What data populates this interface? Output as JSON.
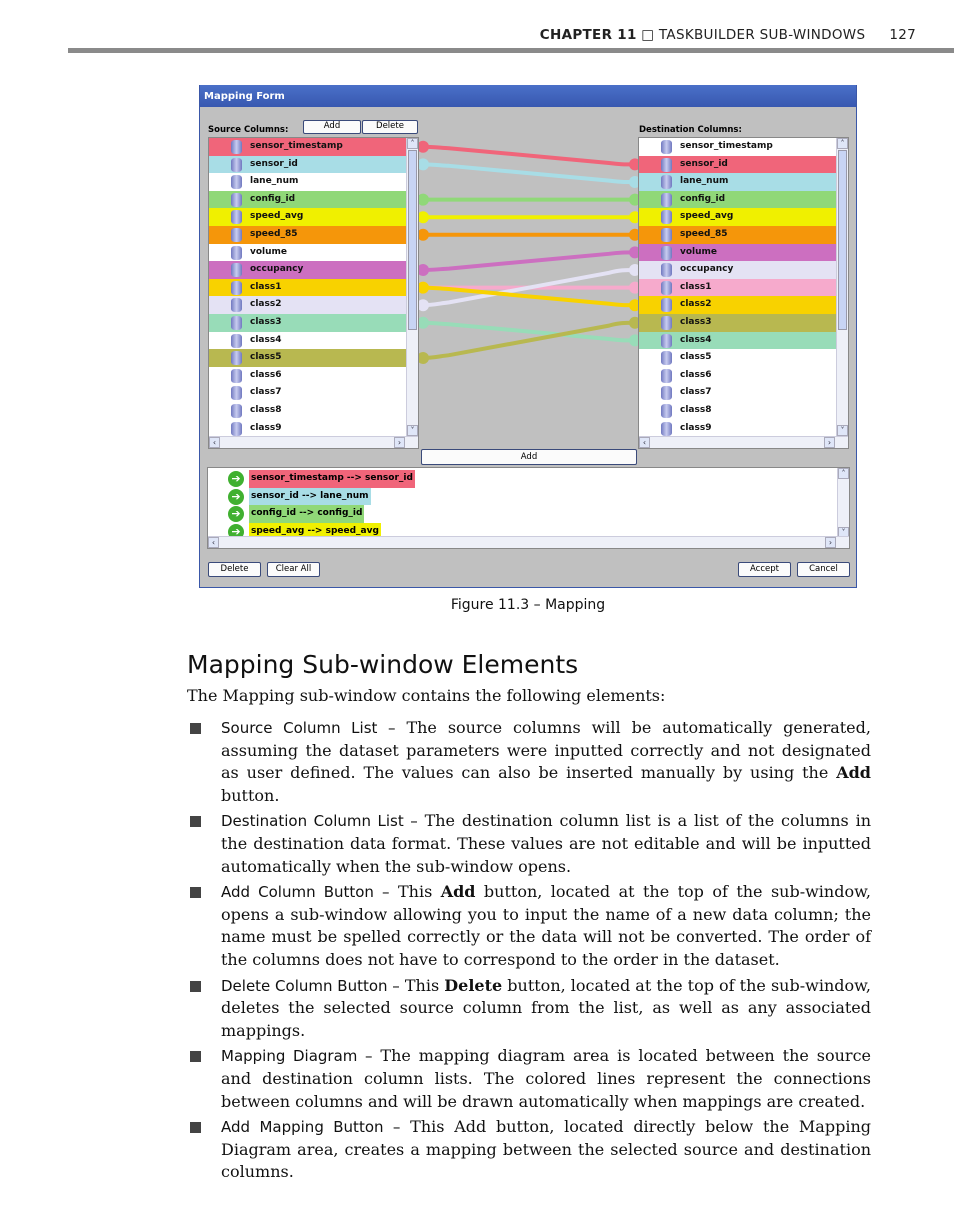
{
  "header": {
    "chapter": "CHAPTER 11",
    "separator": "□",
    "section": "TASKBUILDER SUB-WINDOWS",
    "page": "127"
  },
  "window": {
    "title": "Mapping Form",
    "source_label": "Source Columns:",
    "dest_label": "Destination Columns:",
    "add": "Add",
    "delete": "Delete",
    "add_mapping": "Add",
    "delete_mapping": "Delete",
    "clear_all": "Clear All",
    "accept": "Accept",
    "cancel": "Cancel",
    "source": [
      {
        "name": "sensor_timestamp",
        "color": "#f0657a"
      },
      {
        "name": "sensor_id",
        "color": "#a8dde6"
      },
      {
        "name": "lane_num",
        "color": "#ffffff"
      },
      {
        "name": "config_id",
        "color": "#90d878"
      },
      {
        "name": "speed_avg",
        "color": "#f0f000"
      },
      {
        "name": "speed_85",
        "color": "#f5960a"
      },
      {
        "name": "volume",
        "color": "#ffffff"
      },
      {
        "name": "occupancy",
        "color": "#cc6fc0"
      },
      {
        "name": "class1",
        "color": "#f8d200"
      },
      {
        "name": "class2",
        "color": "#e4e2f4"
      },
      {
        "name": "class3",
        "color": "#98dcb8"
      },
      {
        "name": "class4",
        "color": "#ffffff"
      },
      {
        "name": "class5",
        "color": "#b8b850"
      },
      {
        "name": "class6",
        "color": "#ffffff"
      },
      {
        "name": "class7",
        "color": "#ffffff"
      },
      {
        "name": "class8",
        "color": "#ffffff"
      },
      {
        "name": "class9",
        "color": "#ffffff"
      }
    ],
    "destination": [
      {
        "name": "sensor_timestamp",
        "color": "#ffffff"
      },
      {
        "name": "sensor_id",
        "color": "#f0657a"
      },
      {
        "name": "lane_num",
        "color": "#a8dde6"
      },
      {
        "name": "config_id",
        "color": "#90d878"
      },
      {
        "name": "speed_avg",
        "color": "#f0f000"
      },
      {
        "name": "speed_85",
        "color": "#f5960a"
      },
      {
        "name": "volume",
        "color": "#cc6fc0"
      },
      {
        "name": "occupancy",
        "color": "#e4e2f4"
      },
      {
        "name": "class1",
        "color": "#f6aacc"
      },
      {
        "name": "class2",
        "color": "#f8d200"
      },
      {
        "name": "class3",
        "color": "#b8b850"
      },
      {
        "name": "class4",
        "color": "#98dcb8"
      },
      {
        "name": "class5",
        "color": "#ffffff"
      },
      {
        "name": "class6",
        "color": "#ffffff"
      },
      {
        "name": "class7",
        "color": "#ffffff"
      },
      {
        "name": "class8",
        "color": "#ffffff"
      },
      {
        "name": "class9",
        "color": "#ffffff"
      }
    ],
    "links": [
      {
        "from": 0,
        "to": 1,
        "color": "#f0657a"
      },
      {
        "from": 1,
        "to": 2,
        "color": "#a8dde6"
      },
      {
        "from": 3,
        "to": 3,
        "color": "#90d878"
      },
      {
        "from": 4,
        "to": 4,
        "color": "#f0f000"
      },
      {
        "from": 5,
        "to": 5,
        "color": "#f5960a"
      },
      {
        "from": 7,
        "to": 6,
        "color": "#cc6fc0"
      },
      {
        "from": 8,
        "to": 8,
        "color": "#f6aacc"
      },
      {
        "from": 9,
        "to": 7,
        "color": "#e4e2f4"
      },
      {
        "from": 8,
        "to": 9,
        "color": "#f8d200"
      },
      {
        "from": 10,
        "to": 11,
        "color": "#98dcb8"
      },
      {
        "from": 12,
        "to": 10,
        "color": "#b8b850"
      }
    ],
    "mappings": [
      {
        "text": "sensor_timestamp  -->  sensor_id",
        "color": "#f0657a"
      },
      {
        "text": "sensor_id  -->  lane_num",
        "color": "#a8dde6"
      },
      {
        "text": "config_id  -->  config_id",
        "color": "#90d878"
      },
      {
        "text": "speed_avg  -->  speed_avg",
        "color": "#f0f000"
      }
    ]
  },
  "caption": "Figure 11.3 – Mapping",
  "heading": "Mapping Sub-window Elements",
  "intro": "The Mapping sub-window contains the following elements:",
  "bullets": [
    {
      "term": "Source Column List –",
      "text": " The source columns will be automatically generated, assuming the dataset parameters were inputted correctly and not designated as user defined. The values can also be inserted manually by using the ",
      "bold": "Add",
      "tail": " button."
    },
    {
      "term": "Destination Column List –",
      "text": " The destination column list is a list of the columns in the destination data format. These values are not editable and will be inputted automatically when the sub-window opens.",
      "bold": "",
      "tail": ""
    },
    {
      "term": "Add Column Button –",
      "text": " This ",
      "bold": "Add",
      "tail": " button, located at the top of the sub-window, opens a sub-window allowing you to input the name of a new data column; the name must be spelled correctly or the data will not be converted. The order of the columns does not have to correspond to the order in the dataset."
    },
    {
      "term": "Delete Column Button –",
      "text": " This ",
      "bold": "Delete",
      "tail": " button, located at the top of the sub-window, deletes the selected source column from the list, as well as any associated mappings."
    },
    {
      "term": "Mapping Diagram –",
      "text": " The mapping diagram area is located between the source and destination column lists. The colored lines represent the connections between columns and will be drawn automatically when mappings are created.",
      "bold": "",
      "tail": ""
    },
    {
      "term": "Add Mapping Button –",
      "text": " This Add button, located directly below the Mapping Diagram area, creates a mapping between the selected source and destination columns.",
      "bold": "",
      "tail": ""
    }
  ]
}
